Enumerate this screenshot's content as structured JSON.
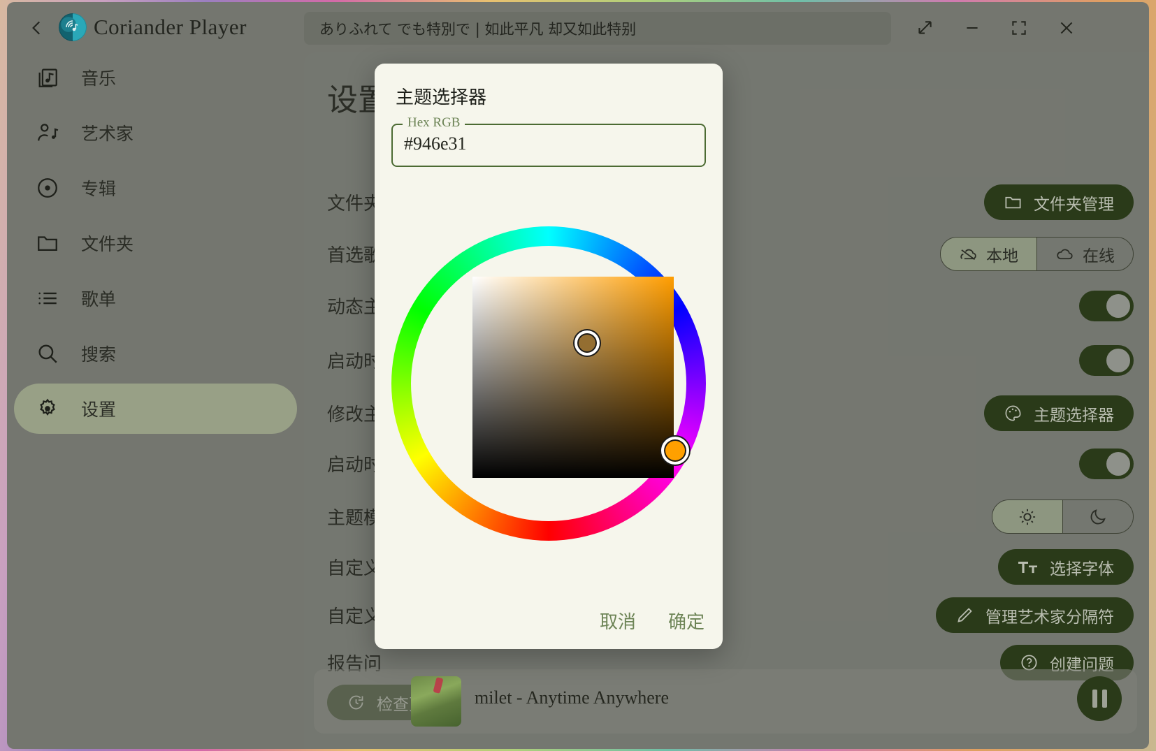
{
  "window": {
    "app_title": "Coriander Player",
    "now_playing_title": "ありふれて でも特別で | 如此平凡 却又如此特别",
    "back_icon": "chevron-left-icon",
    "logo_icon": "coriander-logo-icon",
    "controls": {
      "expand_label": "expand-icon",
      "minimize_label": "minimize-icon",
      "fullscreen_label": "fullscreen-icon",
      "close_label": "close-icon"
    }
  },
  "sidebar": {
    "items": [
      {
        "label": "音乐",
        "icon": "music-library-icon",
        "selected": false
      },
      {
        "label": "艺术家",
        "icon": "artist-icon",
        "selected": false
      },
      {
        "label": "专辑",
        "icon": "album-disc-icon",
        "selected": false
      },
      {
        "label": "文件夹",
        "icon": "folder-icon",
        "selected": false
      },
      {
        "label": "歌单",
        "icon": "playlist-icon",
        "selected": false
      },
      {
        "label": "搜索",
        "icon": "search-icon",
        "selected": false
      },
      {
        "label": "设置",
        "icon": "gear-icon",
        "selected": true
      }
    ]
  },
  "settings": {
    "page_title": "设置",
    "rows": [
      {
        "label": "文件夹",
        "control": "button",
        "button_label": "文件夹管理",
        "icon": "folder-icon"
      },
      {
        "label": "首选歌",
        "control": "segmented",
        "options": [
          "本地",
          "在线"
        ],
        "selected": 0,
        "icons": [
          "cloud-off-icon",
          "cloud-icon"
        ]
      },
      {
        "label": "动态主",
        "control": "switch",
        "on": true
      },
      {
        "label": "启动时",
        "control": "switch",
        "on": true
      },
      {
        "label": "修改主",
        "control": "button",
        "button_label": "主题选择器",
        "icon": "palette-icon"
      },
      {
        "label": "启动时",
        "control": "switch",
        "on": true
      },
      {
        "label": "主题模",
        "control": "segmented-icons",
        "options": [
          "sun-icon",
          "moon-icon"
        ],
        "selected": 0
      },
      {
        "label": "自定义",
        "control": "button",
        "button_label": "选择字体",
        "icon": "text-format-icon"
      },
      {
        "label": "自定义",
        "control": "button",
        "button_label": "管理艺术家分隔符",
        "icon": "pencil-icon"
      },
      {
        "label": "报告问",
        "control": "button",
        "button_label": "创建问题",
        "icon": "help-circle-icon"
      }
    ],
    "check_update_button": "检查更新"
  },
  "dialog": {
    "title": "主题选择器",
    "field_legend": "Hex RGB",
    "field_value": "#946e31",
    "cancel_label": "取消",
    "confirm_label": "确定",
    "picker": {
      "selected_color": "#946e31",
      "hue_thumb_color": "#ffa000"
    }
  },
  "player": {
    "track": "milet - Anytime Anywhere",
    "play_state_icon": "pause-icon"
  }
}
